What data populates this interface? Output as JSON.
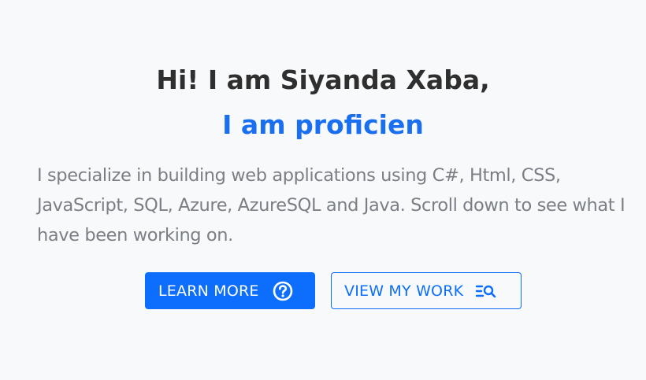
{
  "hero": {
    "heading_line1": "Hi! I am Siyanda Xaba,",
    "heading_line2": "I am proficien",
    "description": "I specialize in building web applications using C#, Html, CSS, JavaScript, SQL, Azure, AzureSQL and Java. Scroll down to see what I have been working on.",
    "buttons": {
      "learn_more": {
        "label": "LEARN MORE",
        "icon": "question-circle-icon"
      },
      "view_work": {
        "label": "VIEW MY WORK",
        "icon": "search-list-icon"
      }
    }
  },
  "colors": {
    "background": "#f8f9fa",
    "heading": "#2f2f2f",
    "accent": "#0d6efd",
    "highlight": "#1a6ff0",
    "body_text": "#7b7f85"
  }
}
